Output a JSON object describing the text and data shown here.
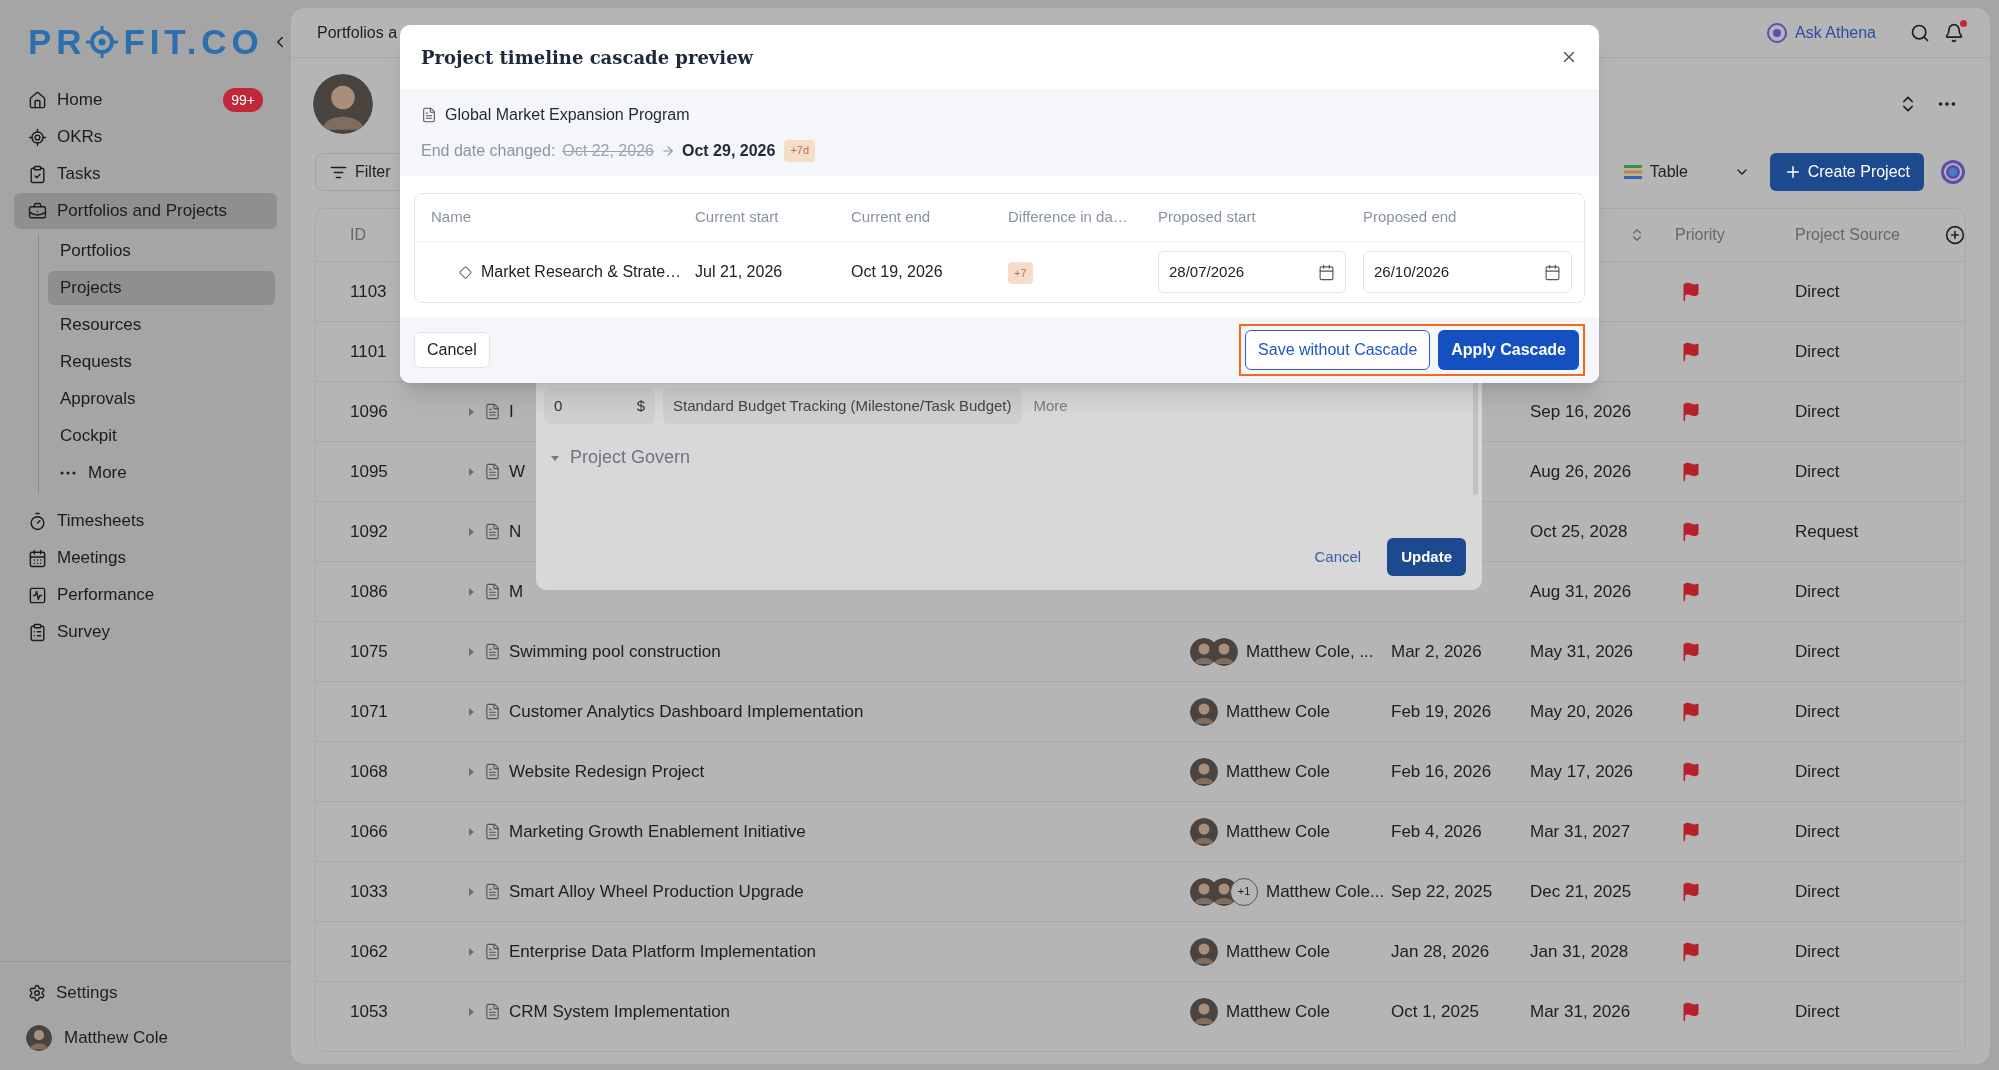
{
  "sidebar": {
    "logo": {
      "before": "PR",
      "after": "FIT.CO"
    },
    "items": [
      {
        "label": "Home",
        "badge": "99+",
        "selected": false
      },
      {
        "label": "OKRs",
        "selected": false
      },
      {
        "label": "Tasks",
        "selected": false
      },
      {
        "label": "Portfolios and Projects",
        "selected": true,
        "children": [
          {
            "label": "Portfolios",
            "selected": false,
            "kind": "link"
          },
          {
            "label": "Projects",
            "selected": true,
            "kind": "link"
          },
          {
            "label": "Resources",
            "selected": false,
            "kind": "link"
          },
          {
            "label": "Requests",
            "selected": false,
            "kind": "link"
          },
          {
            "label": "Approvals",
            "selected": false,
            "kind": "link"
          },
          {
            "label": "Cockpit",
            "selected": false,
            "kind": "link"
          },
          {
            "label": "More",
            "selected": false,
            "kind": "more"
          }
        ]
      },
      {
        "label": "Timesheets",
        "selected": false
      },
      {
        "label": "Meetings",
        "selected": false
      },
      {
        "label": "Performance",
        "selected": false
      },
      {
        "label": "Survey",
        "selected": false
      }
    ],
    "footer": {
      "settings": "Settings",
      "user": "Matthew Cole"
    }
  },
  "top_bar": {
    "breadcrumb": "Portfolios a",
    "assistant": "Ask Athena",
    "notifications": {
      "unread": true
    }
  },
  "toolbar": {
    "filter": "Filter",
    "view": "Table",
    "create": "Create Project"
  },
  "table": {
    "columns": [
      {
        "label": "ID"
      },
      {
        "label": "Priority"
      },
      {
        "label": "Project Source"
      }
    ],
    "rows": [
      {
        "id": "1103",
        "source": "Direct"
      },
      {
        "id": "1101",
        "source": "Direct"
      },
      {
        "id": "1096",
        "name": "I",
        "end": "Sep 16, 2026",
        "source": "Direct"
      },
      {
        "id": "1095",
        "name": "W",
        "end": "Aug 26, 2026",
        "source": "Direct"
      },
      {
        "id": "1092",
        "name": "N",
        "end": "Oct 25, 2028",
        "source": "Request"
      },
      {
        "id": "1086",
        "name": "M",
        "end": "Aug 31, 2026",
        "source": "Direct"
      },
      {
        "id": "1075",
        "name": "Swimming pool construction",
        "owner": "Matthew Cole, ...",
        "avatars": [
          {
            "kind": "photo"
          },
          {
            "kind": "photo"
          }
        ],
        "start": "Mar 2, 2026",
        "end": "May 31, 2026",
        "source": "Direct"
      },
      {
        "id": "1071",
        "name": "Customer Analytics Dashboard Implementation",
        "owner": "Matthew Cole",
        "avatars": [
          {
            "kind": "photo"
          }
        ],
        "start": "Feb 19, 2026",
        "end": "May 20, 2026",
        "source": "Direct"
      },
      {
        "id": "1068",
        "name": "Website Redesign Project",
        "owner": "Matthew Cole",
        "avatars": [
          {
            "kind": "photo"
          }
        ],
        "start": "Feb 16, 2026",
        "end": "May 17, 2026",
        "source": "Direct"
      },
      {
        "id": "1066",
        "name": "Marketing Growth Enablement Initiative",
        "owner": "Matthew Cole",
        "avatars": [
          {
            "kind": "photo"
          }
        ],
        "start": "Feb 4, 2026",
        "end": "Mar 31, 2027",
        "source": "Direct"
      },
      {
        "id": "1033",
        "name": "Smart Alloy Wheel Production Upgrade",
        "owner": "Matthew Cole...",
        "avatars": [
          {
            "kind": "photo"
          },
          {
            "kind": "photo"
          },
          {
            "kind": "more",
            "label": "+1"
          }
        ],
        "start": "Sep 22, 2025",
        "end": "Dec 21, 2025",
        "source": "Direct"
      },
      {
        "id": "1062",
        "name": "Enterprise Data Platform Implementation",
        "owner": "Matthew Cole",
        "avatars": [
          {
            "kind": "photo"
          }
        ],
        "start": "Jan 28, 2026",
        "end": "Jan 31, 2028",
        "source": "Direct"
      },
      {
        "id": "1053",
        "name": "CRM System Implementation",
        "owner": "Matthew Cole",
        "avatars": [
          {
            "kind": "photo"
          }
        ],
        "start": "Oct 1, 2025",
        "end": "Mar 31, 2026",
        "source": "Direct"
      }
    ]
  },
  "edit_dialog": {
    "budget": {
      "value": "0",
      "currency": "$"
    },
    "budget_type": "Standard Budget Tracking (Milestone/Task Budget)",
    "more": "More",
    "section": {
      "label": "Project Govern",
      "expanded": true
    },
    "cancel": "Cancel",
    "update": "Update"
  },
  "cascade_dialog": {
    "title": "Project timeline cascade preview",
    "project": "Global Market Expansion Program",
    "change": {
      "label": "End date changed:",
      "old": "Oct 22, 2026",
      "new": "Oct 29, 2026",
      "badge": "+7d"
    },
    "columns": [
      "Name",
      "Current start",
      "Current end",
      "Difference in da…",
      "Proposed start",
      "Proposed end"
    ],
    "rows": [
      {
        "name": "Market Research & Strate…",
        "current_start": "Jul 21, 2026",
        "current_end": "Oct 19, 2026",
        "difference": "+7",
        "proposed_start": "28/07/2026",
        "proposed_end": "26/10/2026"
      }
    ],
    "cancel": "Cancel",
    "save": "Save without Cascade",
    "apply": "Apply Cascade"
  }
}
